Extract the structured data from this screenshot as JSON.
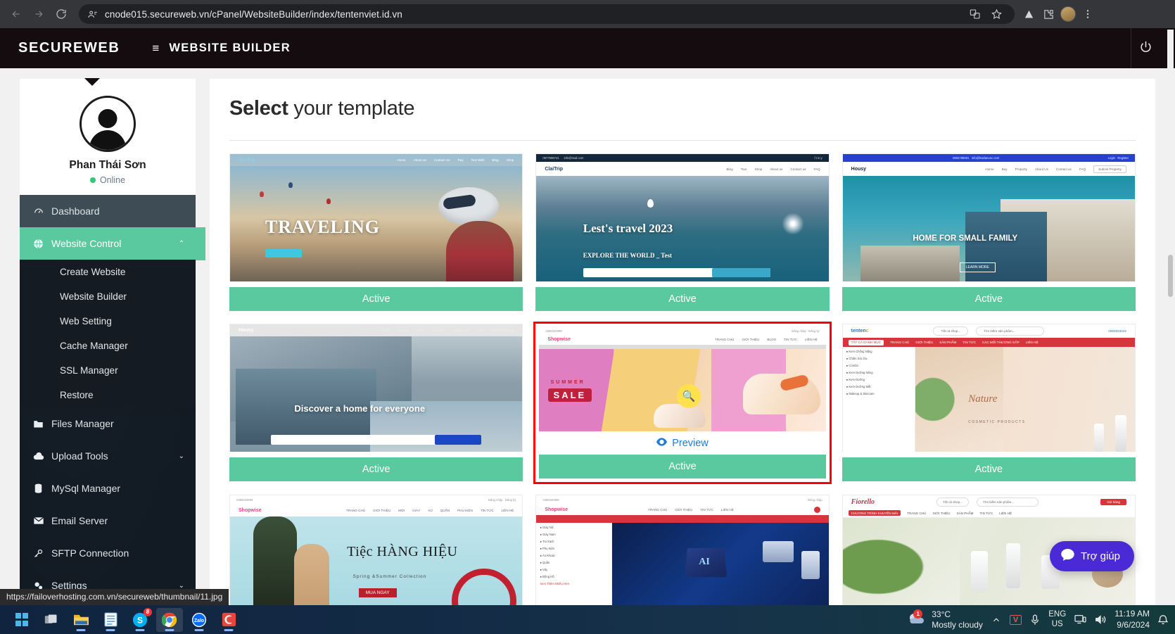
{
  "browser": {
    "url": "cnode015.secureweb.vn/cPanel/WebsiteBuilder/index/tentenviet.id.vn",
    "back_label": "←",
    "forward_label": "→",
    "reload_label": "⟳",
    "icons": {
      "site_settings": "site-settings-icon",
      "translate": "translate-icon",
      "bookmark": "bookmark-star-icon",
      "extension_a": "triangle-extension-icon",
      "extension_b": "puzzle-extension-icon",
      "profile": "profile-avatar-icon",
      "menu": "kebab-menu-icon"
    }
  },
  "app_header": {
    "brand": "SECUREWEB",
    "hamburger": "≡",
    "title": "WEBSITE BUILDER",
    "power_label": "⏻"
  },
  "sidebar": {
    "profile": {
      "name": "Phan Thái Sơn",
      "status": "Online",
      "status_color": "#2ecc71"
    },
    "items": [
      {
        "label": "Dashboard",
        "icon": "speedometer-icon",
        "state": "active-dash",
        "caret": ""
      },
      {
        "label": "Website Control",
        "icon": "globe-icon",
        "state": "active-green",
        "caret": "⌃"
      },
      {
        "label": "Files Manager",
        "icon": "folder-icon",
        "state": "",
        "caret": ""
      },
      {
        "label": "Upload Tools",
        "icon": "cloud-upload-icon",
        "state": "",
        "caret": "⌄"
      },
      {
        "label": "MySql Manager",
        "icon": "database-icon",
        "state": "",
        "caret": ""
      },
      {
        "label": "Email Server",
        "icon": "envelope-icon",
        "state": "",
        "caret": ""
      },
      {
        "label": "SFTP Connection",
        "icon": "key-icon",
        "state": "",
        "caret": ""
      },
      {
        "label": "Settings",
        "icon": "gears-icon",
        "state": "",
        "caret": "⌄"
      }
    ],
    "submenu": [
      {
        "label": "Create Website"
      },
      {
        "label": "Website Builder"
      },
      {
        "label": "Web Setting"
      },
      {
        "label": "Cache Manager"
      },
      {
        "label": "SSL Manager"
      },
      {
        "label": "Restore"
      }
    ]
  },
  "main": {
    "title_bold": "Select",
    "title_rest": " your template",
    "preview_label": "Preview",
    "preview_icon": "eye-icon",
    "active_label": "Active",
    "templates": [
      {
        "id": 1,
        "name": "traveling",
        "hero": "TRAVELING",
        "brand": "VivuTrip",
        "selected": false,
        "button": "Active"
      },
      {
        "id": 2,
        "name": "lets-travel-2023",
        "hero": "Lest's travel 2023",
        "brand": "ClaiTrip",
        "selected": false,
        "button": "Active"
      },
      {
        "id": 3,
        "name": "housy-family",
        "hero": "HOME FOR SMALL FAMILY",
        "brand": "Housy",
        "selected": false,
        "button": "Active"
      },
      {
        "id": 4,
        "name": "discover-home",
        "hero": "Discover a home for everyone",
        "brand": "Housy",
        "selected": false,
        "button": "Active"
      },
      {
        "id": 5,
        "name": "shopwise-summer",
        "hero": "SUMMER SALE",
        "brand": "Shopwise",
        "selected": true,
        "button": "Active"
      },
      {
        "id": 6,
        "name": "tenten-nature",
        "hero": "Nature COSMETIC PRODUCTS",
        "brand": "tentenco",
        "selected": false,
        "button": "Active"
      },
      {
        "id": 7,
        "name": "shopwise-hangieu",
        "hero": "Tiệc HÀNG HIỆU",
        "brand": "Shopwise",
        "selected": false,
        "button": ""
      },
      {
        "id": 8,
        "name": "shopwise-ai",
        "hero": "AI",
        "brand": "Shopwise",
        "selected": false,
        "button": ""
      },
      {
        "id": 9,
        "name": "fiorello",
        "hero": "Fiorello",
        "brand": "Fiorello",
        "selected": false,
        "button": ""
      }
    ],
    "hero_sub_2": "EXPLORE THE WORLD _ Test",
    "hero_sub_3": "LEARN MORE",
    "sale_sub": "SUMMER",
    "sale_main": "SALE",
    "hangieu_sub": "Spring &Summer Collection",
    "hangieu_cta": "MUA NGAY",
    "nature_sub": "COSMETIC PRODUCTS"
  },
  "chat": {
    "label": "Trợ giúp",
    "icon": "chat-bubble-icon",
    "color": "#4a2ad6"
  },
  "status_bar": {
    "url": "https://failoverhosting.com.vn/secureweb/thumbnail/11.jpg"
  },
  "taskbar": {
    "apps": [
      {
        "name": "start-button",
        "label": "",
        "badge": "",
        "running": false,
        "focused": false
      },
      {
        "name": "task-view",
        "label": "",
        "badge": "",
        "running": false,
        "focused": false
      },
      {
        "name": "file-explorer",
        "label": "",
        "badge": "",
        "running": true,
        "focused": false
      },
      {
        "name": "notepad",
        "label": "",
        "badge": "",
        "running": true,
        "focused": false
      },
      {
        "name": "skype",
        "label": "S",
        "badge": "8",
        "running": true,
        "focused": false
      },
      {
        "name": "google-chrome",
        "label": "",
        "badge": "",
        "running": true,
        "focused": true
      },
      {
        "name": "zalo",
        "label": "Zalo",
        "badge": "",
        "running": true,
        "focused": false
      },
      {
        "name": "coccoc-browser",
        "label": "C",
        "badge": "",
        "running": true,
        "focused": false
      }
    ],
    "weather": {
      "temp": "33°C",
      "desc": "Mostly cloudy",
      "badge": "1",
      "icon": "cloud-icon"
    },
    "tray": {
      "chevron": "⌃",
      "unikey": "V",
      "mic": "mic-icon",
      "lang_top": "ENG",
      "lang_bottom": "US",
      "monitor": "monitor-icon",
      "volume": "speaker-icon",
      "notification": "bell-icon"
    },
    "clock": {
      "time": "11:19 AM",
      "date": "9/6/2024"
    }
  }
}
